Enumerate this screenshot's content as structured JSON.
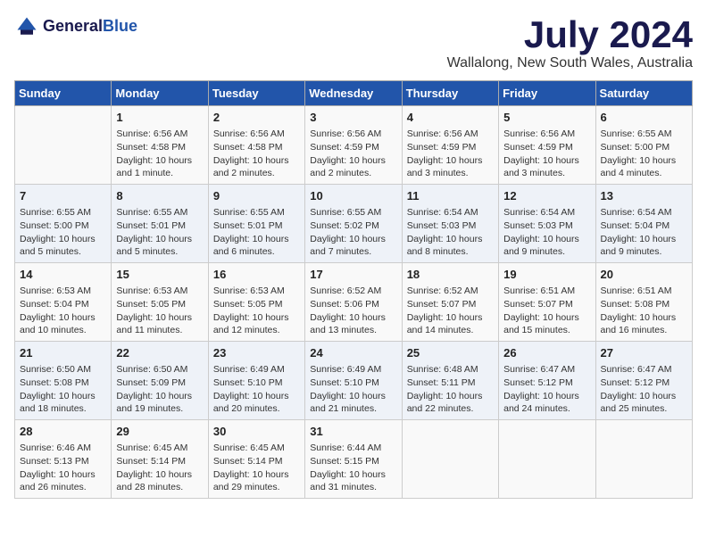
{
  "logo": {
    "line1": "General",
    "line2": "Blue"
  },
  "title": "July 2024",
  "location": "Wallalong, New South Wales, Australia",
  "days_of_week": [
    "Sunday",
    "Monday",
    "Tuesday",
    "Wednesday",
    "Thursday",
    "Friday",
    "Saturday"
  ],
  "weeks": [
    [
      {
        "day": "",
        "info": ""
      },
      {
        "day": "1",
        "info": "Sunrise: 6:56 AM\nSunset: 4:58 PM\nDaylight: 10 hours\nand 1 minute."
      },
      {
        "day": "2",
        "info": "Sunrise: 6:56 AM\nSunset: 4:58 PM\nDaylight: 10 hours\nand 2 minutes."
      },
      {
        "day": "3",
        "info": "Sunrise: 6:56 AM\nSunset: 4:59 PM\nDaylight: 10 hours\nand 2 minutes."
      },
      {
        "day": "4",
        "info": "Sunrise: 6:56 AM\nSunset: 4:59 PM\nDaylight: 10 hours\nand 3 minutes."
      },
      {
        "day": "5",
        "info": "Sunrise: 6:56 AM\nSunset: 4:59 PM\nDaylight: 10 hours\nand 3 minutes."
      },
      {
        "day": "6",
        "info": "Sunrise: 6:55 AM\nSunset: 5:00 PM\nDaylight: 10 hours\nand 4 minutes."
      }
    ],
    [
      {
        "day": "7",
        "info": "Sunrise: 6:55 AM\nSunset: 5:00 PM\nDaylight: 10 hours\nand 5 minutes."
      },
      {
        "day": "8",
        "info": "Sunrise: 6:55 AM\nSunset: 5:01 PM\nDaylight: 10 hours\nand 5 minutes."
      },
      {
        "day": "9",
        "info": "Sunrise: 6:55 AM\nSunset: 5:01 PM\nDaylight: 10 hours\nand 6 minutes."
      },
      {
        "day": "10",
        "info": "Sunrise: 6:55 AM\nSunset: 5:02 PM\nDaylight: 10 hours\nand 7 minutes."
      },
      {
        "day": "11",
        "info": "Sunrise: 6:54 AM\nSunset: 5:03 PM\nDaylight: 10 hours\nand 8 minutes."
      },
      {
        "day": "12",
        "info": "Sunrise: 6:54 AM\nSunset: 5:03 PM\nDaylight: 10 hours\nand 9 minutes."
      },
      {
        "day": "13",
        "info": "Sunrise: 6:54 AM\nSunset: 5:04 PM\nDaylight: 10 hours\nand 9 minutes."
      }
    ],
    [
      {
        "day": "14",
        "info": "Sunrise: 6:53 AM\nSunset: 5:04 PM\nDaylight: 10 hours\nand 10 minutes."
      },
      {
        "day": "15",
        "info": "Sunrise: 6:53 AM\nSunset: 5:05 PM\nDaylight: 10 hours\nand 11 minutes."
      },
      {
        "day": "16",
        "info": "Sunrise: 6:53 AM\nSunset: 5:05 PM\nDaylight: 10 hours\nand 12 minutes."
      },
      {
        "day": "17",
        "info": "Sunrise: 6:52 AM\nSunset: 5:06 PM\nDaylight: 10 hours\nand 13 minutes."
      },
      {
        "day": "18",
        "info": "Sunrise: 6:52 AM\nSunset: 5:07 PM\nDaylight: 10 hours\nand 14 minutes."
      },
      {
        "day": "19",
        "info": "Sunrise: 6:51 AM\nSunset: 5:07 PM\nDaylight: 10 hours\nand 15 minutes."
      },
      {
        "day": "20",
        "info": "Sunrise: 6:51 AM\nSunset: 5:08 PM\nDaylight: 10 hours\nand 16 minutes."
      }
    ],
    [
      {
        "day": "21",
        "info": "Sunrise: 6:50 AM\nSunset: 5:08 PM\nDaylight: 10 hours\nand 18 minutes."
      },
      {
        "day": "22",
        "info": "Sunrise: 6:50 AM\nSunset: 5:09 PM\nDaylight: 10 hours\nand 19 minutes."
      },
      {
        "day": "23",
        "info": "Sunrise: 6:49 AM\nSunset: 5:10 PM\nDaylight: 10 hours\nand 20 minutes."
      },
      {
        "day": "24",
        "info": "Sunrise: 6:49 AM\nSunset: 5:10 PM\nDaylight: 10 hours\nand 21 minutes."
      },
      {
        "day": "25",
        "info": "Sunrise: 6:48 AM\nSunset: 5:11 PM\nDaylight: 10 hours\nand 22 minutes."
      },
      {
        "day": "26",
        "info": "Sunrise: 6:47 AM\nSunset: 5:12 PM\nDaylight: 10 hours\nand 24 minutes."
      },
      {
        "day": "27",
        "info": "Sunrise: 6:47 AM\nSunset: 5:12 PM\nDaylight: 10 hours\nand 25 minutes."
      }
    ],
    [
      {
        "day": "28",
        "info": "Sunrise: 6:46 AM\nSunset: 5:13 PM\nDaylight: 10 hours\nand 26 minutes."
      },
      {
        "day": "29",
        "info": "Sunrise: 6:45 AM\nSunset: 5:14 PM\nDaylight: 10 hours\nand 28 minutes."
      },
      {
        "day": "30",
        "info": "Sunrise: 6:45 AM\nSunset: 5:14 PM\nDaylight: 10 hours\nand 29 minutes."
      },
      {
        "day": "31",
        "info": "Sunrise: 6:44 AM\nSunset: 5:15 PM\nDaylight: 10 hours\nand 31 minutes."
      },
      {
        "day": "",
        "info": ""
      },
      {
        "day": "",
        "info": ""
      },
      {
        "day": "",
        "info": ""
      }
    ]
  ]
}
